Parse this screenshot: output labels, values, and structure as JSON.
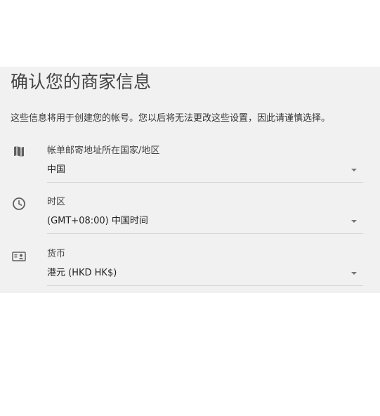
{
  "page": {
    "title": "确认您的商家信息",
    "description": "这些信息将用于创建您的帐号。您以后将无法更改这些设置，因此请谨慎选择。"
  },
  "fields": {
    "country": {
      "label": "帐单邮寄地址所在国家/地区",
      "value": "中国",
      "icon": "map-icon"
    },
    "timezone": {
      "label": "时区",
      "value": "(GMT+08:00) 中国时间",
      "icon": "clock-icon"
    },
    "currency": {
      "label": "货币",
      "value": "港元 (HKD HK$)",
      "icon": "currency-icon"
    }
  }
}
